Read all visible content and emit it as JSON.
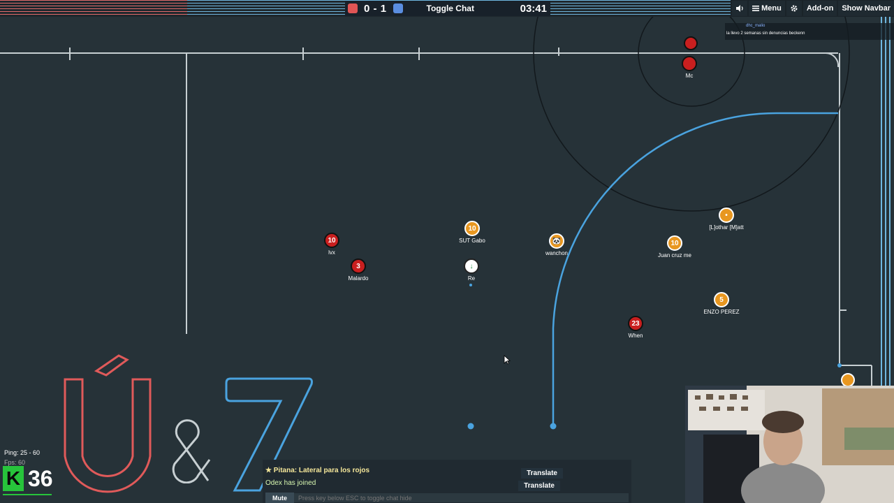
{
  "topbar": {
    "score_red": "0",
    "score_sep": "-",
    "score_blue": "1",
    "toggle_chat": "Toggle Chat",
    "timer": "03:41",
    "menu_label": "Menu",
    "addon_label": "Add-on",
    "show_navbar_label": "Show Navbar"
  },
  "notification": {
    "user": "dhc_malio",
    "text": "la llevo 2 semanas sin denuncias beckenn"
  },
  "players": [
    {
      "name": "lvx",
      "number": "10",
      "team": "red"
    },
    {
      "name": "Malardo",
      "number": "3",
      "team": "red"
    },
    {
      "name": "SUT Gabo",
      "number": "10",
      "team": "blue"
    },
    {
      "name": "Re",
      "number": "↓",
      "team": "neutral"
    },
    {
      "name": "wanchon",
      "number": "🐼",
      "team": "blue"
    },
    {
      "name": "Juan cruz me",
      "number": "10",
      "team": "blue"
    },
    {
      "name": "[L]othar [M]att",
      "number": "•",
      "team": "blue"
    },
    {
      "name": "ENZO PEREZ",
      "number": "5",
      "team": "blue"
    },
    {
      "name": "When",
      "number": "23",
      "team": "red"
    },
    {
      "name": "Mc",
      "number": "",
      "team": "red"
    }
  ],
  "chat": {
    "line1": "Pitana: Lateral para los rojos",
    "line2": "Odex has joined",
    "translate1": "Translate",
    "translate2": "Translate",
    "mute": "Mute",
    "placeholder": "Press key below ESC to toggle chat hide"
  },
  "stats": {
    "ping": "Ping: 25 - 60",
    "fps": "Fps: 60",
    "k": "K",
    "fps_big": "36"
  },
  "colors": {
    "field": "#263238",
    "red_team": "#e05555",
    "blue_team": "#5a8de0",
    "line_white": "#c7cfd2",
    "line_blue": "#4aa3df"
  }
}
